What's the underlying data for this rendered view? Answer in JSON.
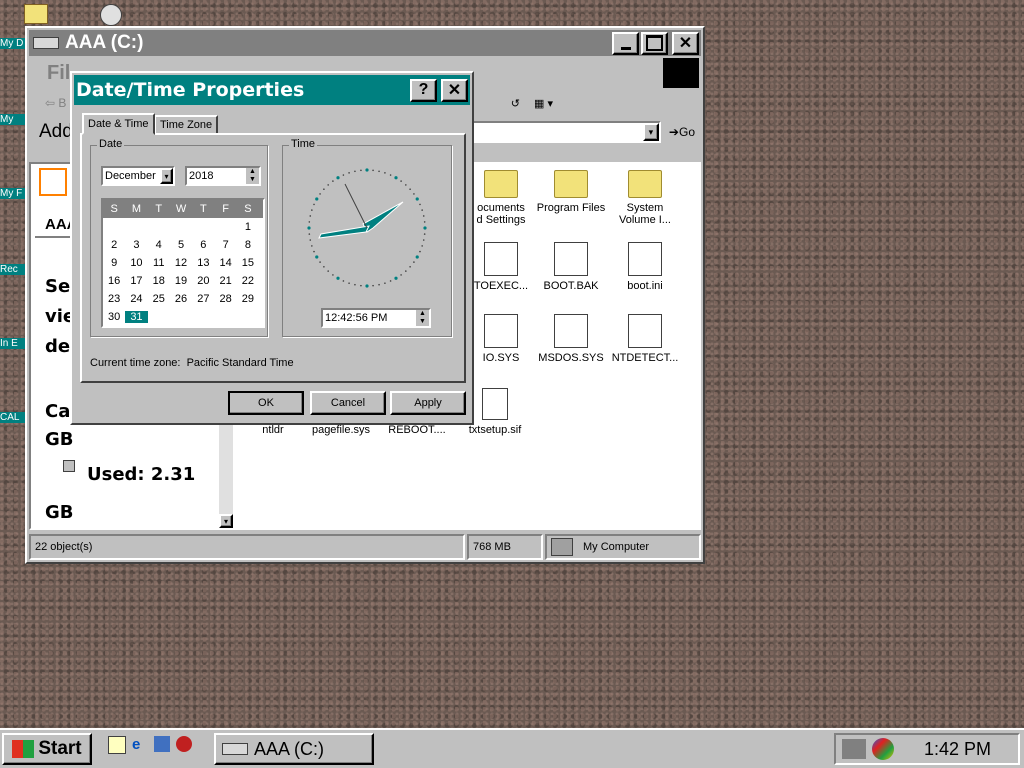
{
  "desktop": {
    "icons": [
      {
        "label": "My D"
      },
      {
        "label": "My"
      },
      {
        "label": "My F"
      },
      {
        "label": "Rec"
      },
      {
        "label": "In E"
      },
      {
        "label": "CAL"
      }
    ]
  },
  "explorer": {
    "title": "AAA (C:)",
    "menu_label": "Fil",
    "back_label": "B",
    "address_label": "Add",
    "go_label": "Go",
    "left_pane": {
      "drive_label": "AAA",
      "text_lines": [
        "Sel",
        "vie",
        "des"
      ],
      "capacity_label": "Cap",
      "capacity_unit": "GB",
      "used_label": "Used: 2.31",
      "used_unit": "GB"
    },
    "files": [
      {
        "name": "ocuments\nd Settings",
        "kind": "folder"
      },
      {
        "name": "Program Files",
        "kind": "folder"
      },
      {
        "name": "System\nVolume I...",
        "kind": "folder"
      },
      {
        "name": "TOEXEC...",
        "kind": "doc"
      },
      {
        "name": "BOOT.BAK",
        "kind": "doc"
      },
      {
        "name": "boot.ini",
        "kind": "doc"
      },
      {
        "name": "IO.SYS",
        "kind": "doc"
      },
      {
        "name": "MSDOS.SYS",
        "kind": "doc"
      },
      {
        "name": "NTDETECT...",
        "kind": "doc"
      },
      {
        "name": "ntldr",
        "kind": "doc"
      },
      {
        "name": "pagefile.sys",
        "kind": "doc"
      },
      {
        "name": "REBOOT....",
        "kind": "doc"
      },
      {
        "name": "txtsetup.sif",
        "kind": "doc"
      }
    ],
    "status": {
      "objects": "22 object(s)",
      "size": "768 MB",
      "location": "My Computer"
    }
  },
  "dialog": {
    "title": "Date/Time Properties",
    "help_glyph": "?",
    "close_glyph": "✕",
    "tabs": [
      "Date & Time",
      "Time Zone"
    ],
    "date_group": "Date",
    "time_group": "Time",
    "month": "December",
    "year": "2018",
    "weekdays": [
      "S",
      "M",
      "T",
      "W",
      "T",
      "F",
      "S"
    ],
    "days": [
      "",
      "",
      "",
      "",
      "",
      "",
      "1",
      "2",
      "3",
      "4",
      "5",
      "6",
      "7",
      "8",
      "9",
      "10",
      "11",
      "12",
      "13",
      "14",
      "15",
      "16",
      "17",
      "18",
      "19",
      "20",
      "21",
      "22",
      "23",
      "24",
      "25",
      "26",
      "27",
      "28",
      "29",
      "30",
      "31"
    ],
    "selected_day": "31",
    "time_value": "12:42:56 PM",
    "timezone_text": "Current time zone:  Pacific Standard Time",
    "buttons": {
      "ok": "OK",
      "cancel": "Cancel",
      "apply": "Apply"
    }
  },
  "taskbar": {
    "start_label": "Start",
    "task_label": "AAA (C:)",
    "clock": "1:42 PM"
  },
  "colors": {
    "dialog_title": "#008080",
    "inactive_title": "#808080",
    "face": "#c0c0c0"
  }
}
